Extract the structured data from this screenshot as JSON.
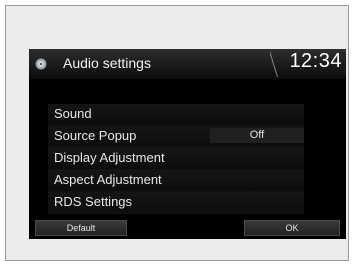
{
  "header": {
    "icon": "settings-icon",
    "title": "Audio settings",
    "clock": "12:34"
  },
  "menu": {
    "items": [
      {
        "label": "Sound"
      },
      {
        "label": "Source Popup",
        "value": "Off"
      },
      {
        "label": "Display Adjustment"
      },
      {
        "label": "Aspect Adjustment"
      },
      {
        "label": "RDS Settings"
      }
    ]
  },
  "footer": {
    "default_label": "Default",
    "ok_label": "OK"
  }
}
